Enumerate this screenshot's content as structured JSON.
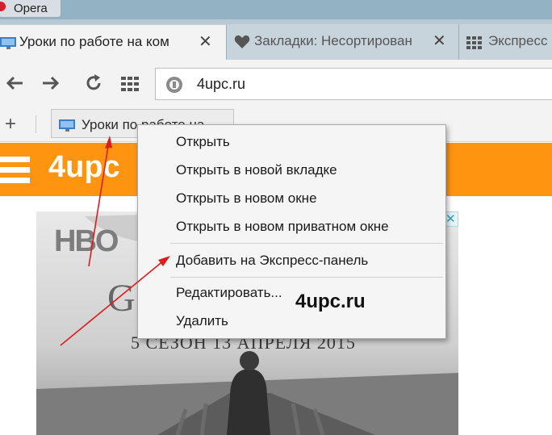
{
  "browser": {
    "app_name": "Opera"
  },
  "tabs": [
    {
      "label": "Уроки по работе на ком",
      "icon": "monitor-favicon-icon",
      "active": true
    },
    {
      "label": "Закладки: Несортирован",
      "icon": "heart-icon",
      "active": false
    },
    {
      "label": "Экспресс",
      "icon": "grid-icon",
      "active": false
    }
  ],
  "toolbar": {
    "address": "4upc.ru"
  },
  "bookmarks_bar": {
    "item_label": "Уроки по работе на"
  },
  "site": {
    "logo_text": "4upc"
  },
  "ad": {
    "banner_text": "5 СЕЗОН 13 АПРЕЛЯ 2015",
    "brand": "HBO",
    "letter": "G"
  },
  "context_menu": {
    "items": [
      "Открыть",
      "Открыть в новой вкладке",
      "Открыть в новом окне",
      "Открыть в новом приватном окне",
      "Добавить на Экспресс-панель",
      "Редактировать...",
      "Удалить"
    ]
  },
  "watermark": "4upc.ru",
  "colors": {
    "accent_orange": "#ff9410",
    "arrow_red": "#e01b1b",
    "opera_red": "#d6202e"
  }
}
